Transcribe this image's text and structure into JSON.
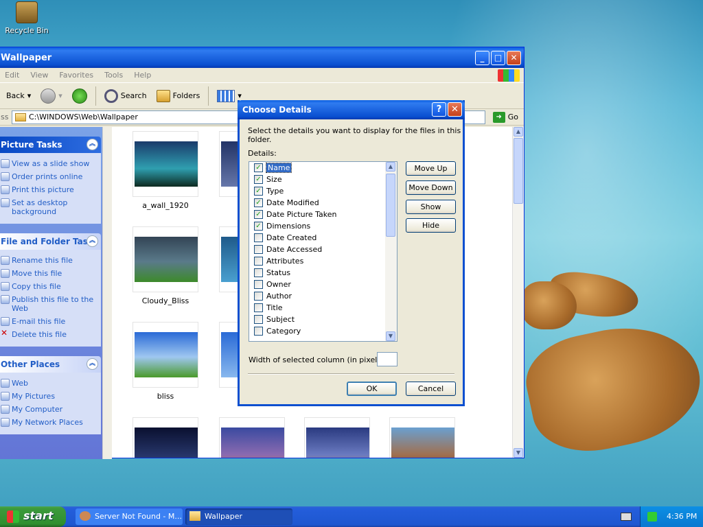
{
  "desktop": {
    "recycle_bin": "Recycle Bin"
  },
  "window": {
    "title": "Wallpaper",
    "menu": [
      "Edit",
      "View",
      "Favorites",
      "Tools",
      "Help"
    ],
    "toolbar": {
      "back": "Back",
      "search": "Search",
      "folders": "Folders"
    },
    "address": {
      "label": "Address",
      "path": "C:\\WINDOWS\\Web\\Wallpaper",
      "go": "Go"
    },
    "panels": [
      {
        "title": "Picture Tasks",
        "primary": true,
        "items": [
          "View as a slide show",
          "Order prints online",
          "Print this picture",
          "Set as desktop background"
        ]
      },
      {
        "title": "File and Folder Tasks",
        "primary": false,
        "items": [
          "Rename this file",
          "Move this file",
          "Copy this file",
          "Publish this file to the Web",
          "E-mail this file",
          "Delete this file"
        ]
      },
      {
        "title": "Other Places",
        "primary": false,
        "items": [
          "Web",
          "My Pictures",
          "My Computer",
          "My Network Places"
        ]
      }
    ],
    "thumbnails": [
      {
        "label": "a_wall_1920",
        "colors": [
          "#1a3a6a",
          "#2f9fb0",
          "#0d2a20"
        ]
      },
      {
        "label": "Cloudy_Bliss",
        "colors": [
          "#334455",
          "#5a7a8a",
          "#3d8a2a"
        ]
      },
      {
        "label": "bliss",
        "colors": [
          "#2a6ad6",
          "#9fc7f0",
          "#4a9a2a"
        ]
      }
    ]
  },
  "dialog": {
    "title": "Choose Details",
    "instruction": "Select the details you want to display for the files in this folder.",
    "details_label": "Details:",
    "items": [
      {
        "name": "Name",
        "checked": true,
        "selected": true
      },
      {
        "name": "Size",
        "checked": true
      },
      {
        "name": "Type",
        "checked": true
      },
      {
        "name": "Date Modified",
        "checked": true
      },
      {
        "name": "Date Picture Taken",
        "checked": true
      },
      {
        "name": "Dimensions",
        "checked": true
      },
      {
        "name": "Date Created",
        "checked": false
      },
      {
        "name": "Date Accessed",
        "checked": false
      },
      {
        "name": "Attributes",
        "checked": false
      },
      {
        "name": "Status",
        "checked": false
      },
      {
        "name": "Owner",
        "checked": false
      },
      {
        "name": "Author",
        "checked": false
      },
      {
        "name": "Title",
        "checked": false
      },
      {
        "name": "Subject",
        "checked": false
      },
      {
        "name": "Category",
        "checked": false
      }
    ],
    "buttons": {
      "move_up": "Move Up",
      "move_down": "Move Down",
      "show": "Show",
      "hide": "Hide",
      "ok": "OK",
      "cancel": "Cancel"
    },
    "width_label": "Width of selected column (in pixels):",
    "width_value": ""
  },
  "taskbar": {
    "start": "start",
    "tasks": [
      "Server Not Found - M...",
      "Wallpaper"
    ],
    "clock": "4:36 PM"
  }
}
